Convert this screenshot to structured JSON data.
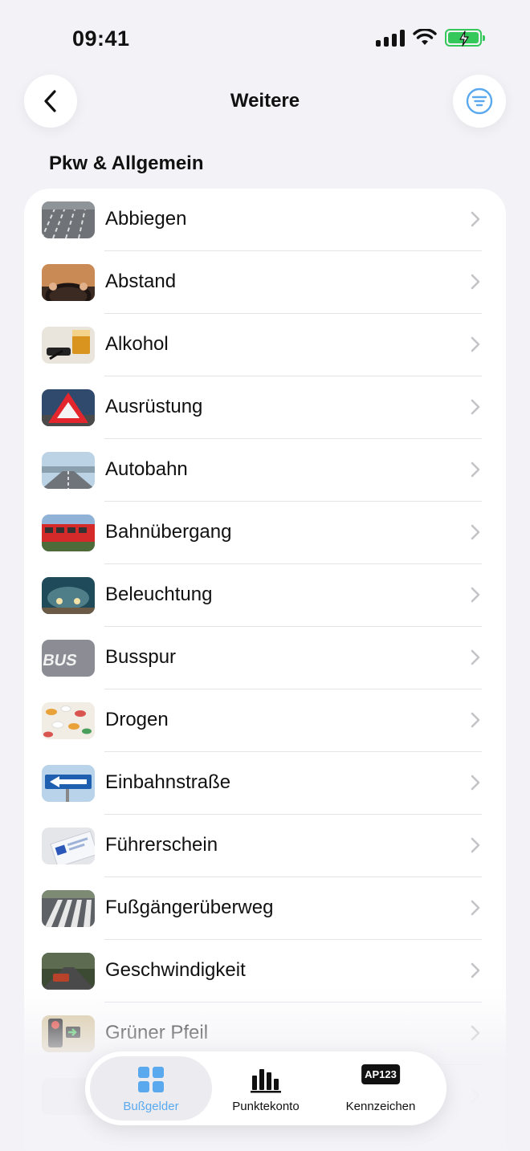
{
  "status_bar": {
    "time": "09:41",
    "battery_color": "#34c759"
  },
  "nav": {
    "title": "Weitere",
    "back_icon": "chevron-left-icon",
    "filter_icon": "filter-icon",
    "accent": "#5aa9ee"
  },
  "section": {
    "title": "Pkw & Allgemein"
  },
  "list": {
    "items": [
      {
        "label": "Abbiegen",
        "thumb": "road-lanes"
      },
      {
        "label": "Abstand",
        "thumb": "steering-wheel"
      },
      {
        "label": "Alkohol",
        "thumb": "whiskey-glass"
      },
      {
        "label": "Ausrüstung",
        "thumb": "warning-triangle"
      },
      {
        "label": "Autobahn",
        "thumb": "highway"
      },
      {
        "label": "Bahnübergang",
        "thumb": "train"
      },
      {
        "label": "Beleuchtung",
        "thumb": "headlights"
      },
      {
        "label": "Busspur",
        "thumb": "bus-lane"
      },
      {
        "label": "Drogen",
        "thumb": "pills"
      },
      {
        "label": "Einbahnstraße",
        "thumb": "one-way-sign"
      },
      {
        "label": "Führerschein",
        "thumb": "license-card"
      },
      {
        "label": "Fußgängerüberweg",
        "thumb": "crosswalk"
      },
      {
        "label": "Geschwindigkeit",
        "thumb": "speed-road"
      },
      {
        "label": "Grüner Pfeil",
        "thumb": "green-arrow-light"
      }
    ]
  },
  "tab_bar": {
    "tabs": [
      {
        "label": "Bußgelder",
        "icon": "grid-icon",
        "active": true
      },
      {
        "label": "Punktekonto",
        "icon": "bar-chart-icon",
        "active": false
      },
      {
        "label": "Kennzeichen",
        "icon": "license-plate-icon",
        "active": false,
        "plate_text": "AP123"
      }
    ]
  }
}
